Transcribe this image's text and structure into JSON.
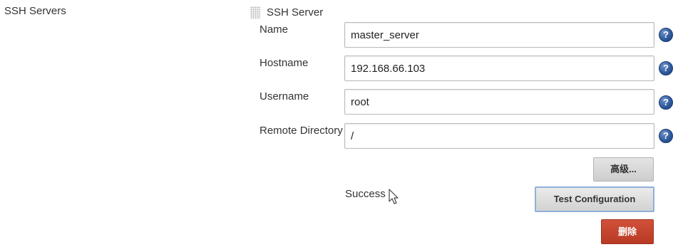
{
  "section": {
    "label": "SSH Servers"
  },
  "server": {
    "title": "SSH Server",
    "fields": {
      "name": {
        "label": "Name",
        "value": "master_server"
      },
      "hostname": {
        "label": "Hostname",
        "value": "192.168.66.103"
      },
      "username": {
        "label": "Username",
        "value": "root"
      },
      "remote_directory": {
        "label": "Remote Directory",
        "value": "/"
      }
    },
    "help_icon_glyph": "?",
    "icons": {
      "help": "help-icon",
      "drag": "drag-handle-icon",
      "cursor": "mouse-pointer-icon"
    }
  },
  "actions": {
    "advanced_label": "高级...",
    "test_label": "Test Configuration",
    "delete_label": "删除",
    "status": "Success"
  },
  "colors": {
    "delete_button": "#c0412b",
    "help_icon": "#2f5b9e",
    "focus_border": "#8fb0d9"
  }
}
